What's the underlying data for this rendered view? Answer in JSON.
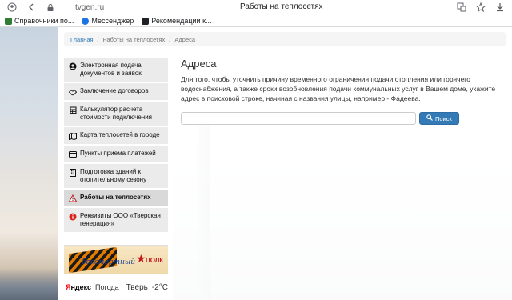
{
  "browser": {
    "url": "tvgen.ru",
    "tab_title": "Работы на теплосетях",
    "bookmarks": [
      {
        "label": "Справочники по...",
        "color": "#2e7d32"
      },
      {
        "label": "Мессенджер",
        "color": "#1a73e8"
      },
      {
        "label": "Рекомендации к...",
        "color": "#202124"
      }
    ]
  },
  "breadcrumb": {
    "home": "Главная",
    "section": "Работы на теплосетях",
    "current": "Адреса"
  },
  "sidebar": {
    "items": [
      {
        "label": "Электронная подача документов и заявок",
        "icon": "user-circle-icon"
      },
      {
        "label": "Заключение договоров",
        "icon": "handshake-icon"
      },
      {
        "label": "Калькулятор расчета стоимости подключения",
        "icon": "calculator-icon"
      },
      {
        "label": "Карта теплосетей в городе",
        "icon": "map-icon"
      },
      {
        "label": "Пункты приема платежей",
        "icon": "credit-card-icon"
      },
      {
        "label": "Подготовка зданий к отопительному сезону",
        "icon": "building-icon"
      },
      {
        "label": "Работы на теплосетях",
        "icon": "warning-icon"
      },
      {
        "label": "Реквизиты ООО «Тверская генерация»",
        "icon": "info-icon"
      }
    ],
    "active_index": 6
  },
  "banner": {
    "script_text": "бессмертный",
    "polk_text": "ПОЛК"
  },
  "weather": {
    "brand": "Яндекс",
    "service": "Погода",
    "city": "Тверь",
    "temperature": "-2°C"
  },
  "content": {
    "title": "Адреса",
    "description": "Для того, чтобы уточнить причину временного ограничения подачи отопления или горячего водоснабжения, а также сроки возобновления подачи коммунальных услуг в Вашем доме, укажите адрес в поисковой строке, начиная с названия улицы, например - Фадеева.",
    "search_value": "",
    "search_button": "Поиск"
  },
  "colors": {
    "accent": "#337ab7",
    "sidebar_bg": "#ebebeb",
    "sidebar_active_bg": "#d9d9d9"
  }
}
